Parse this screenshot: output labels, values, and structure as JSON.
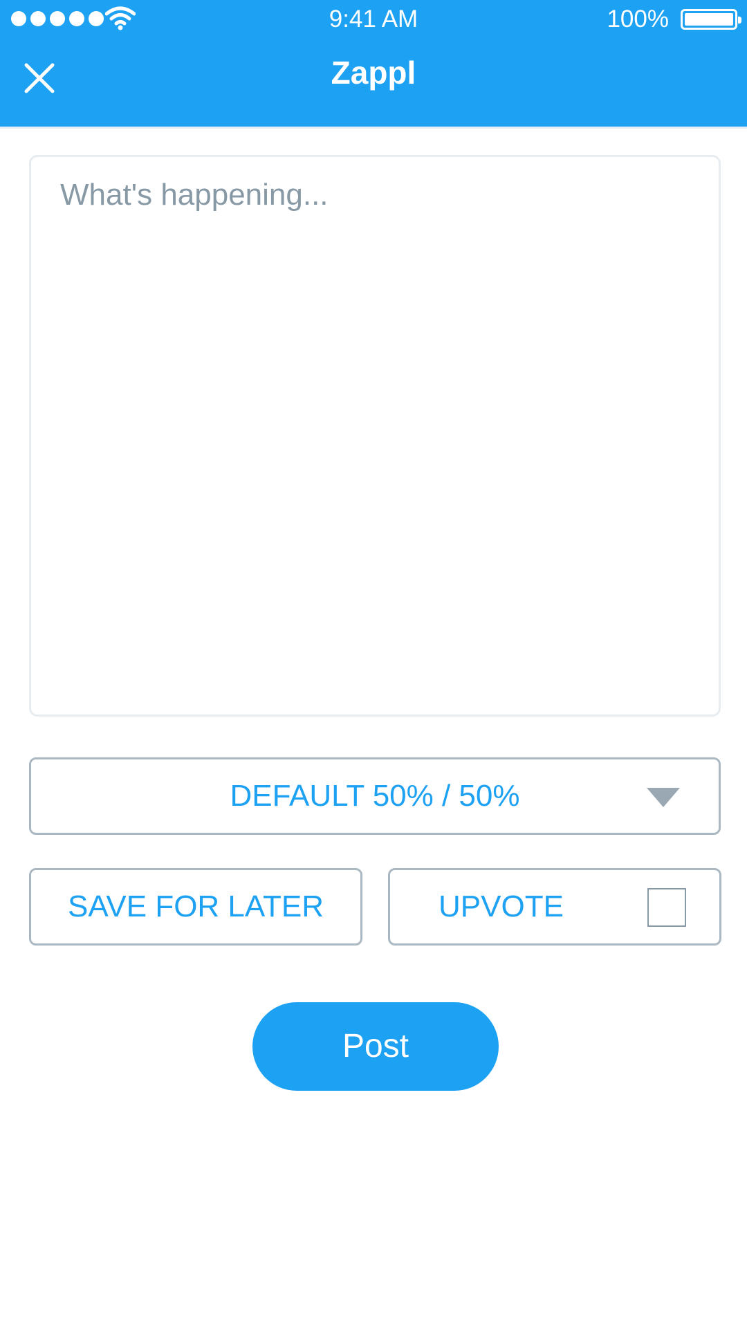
{
  "status_bar": {
    "time": "9:41 AM",
    "battery_percent": "100%",
    "signal_bars": 5
  },
  "header": {
    "title": "Zappl",
    "close_icon": "close-icon"
  },
  "compose": {
    "placeholder": "What's happening...",
    "value": ""
  },
  "split_dropdown": {
    "selected": "DEFAULT 50% / 50%"
  },
  "actions": {
    "save_label": "SAVE FOR LATER",
    "upvote_label": "UPVOTE",
    "upvote_checked": false
  },
  "post_button": {
    "label": "Post"
  },
  "colors": {
    "accent": "#1da1f2",
    "border": "#aab8c2",
    "placeholder": "#8899a6"
  }
}
